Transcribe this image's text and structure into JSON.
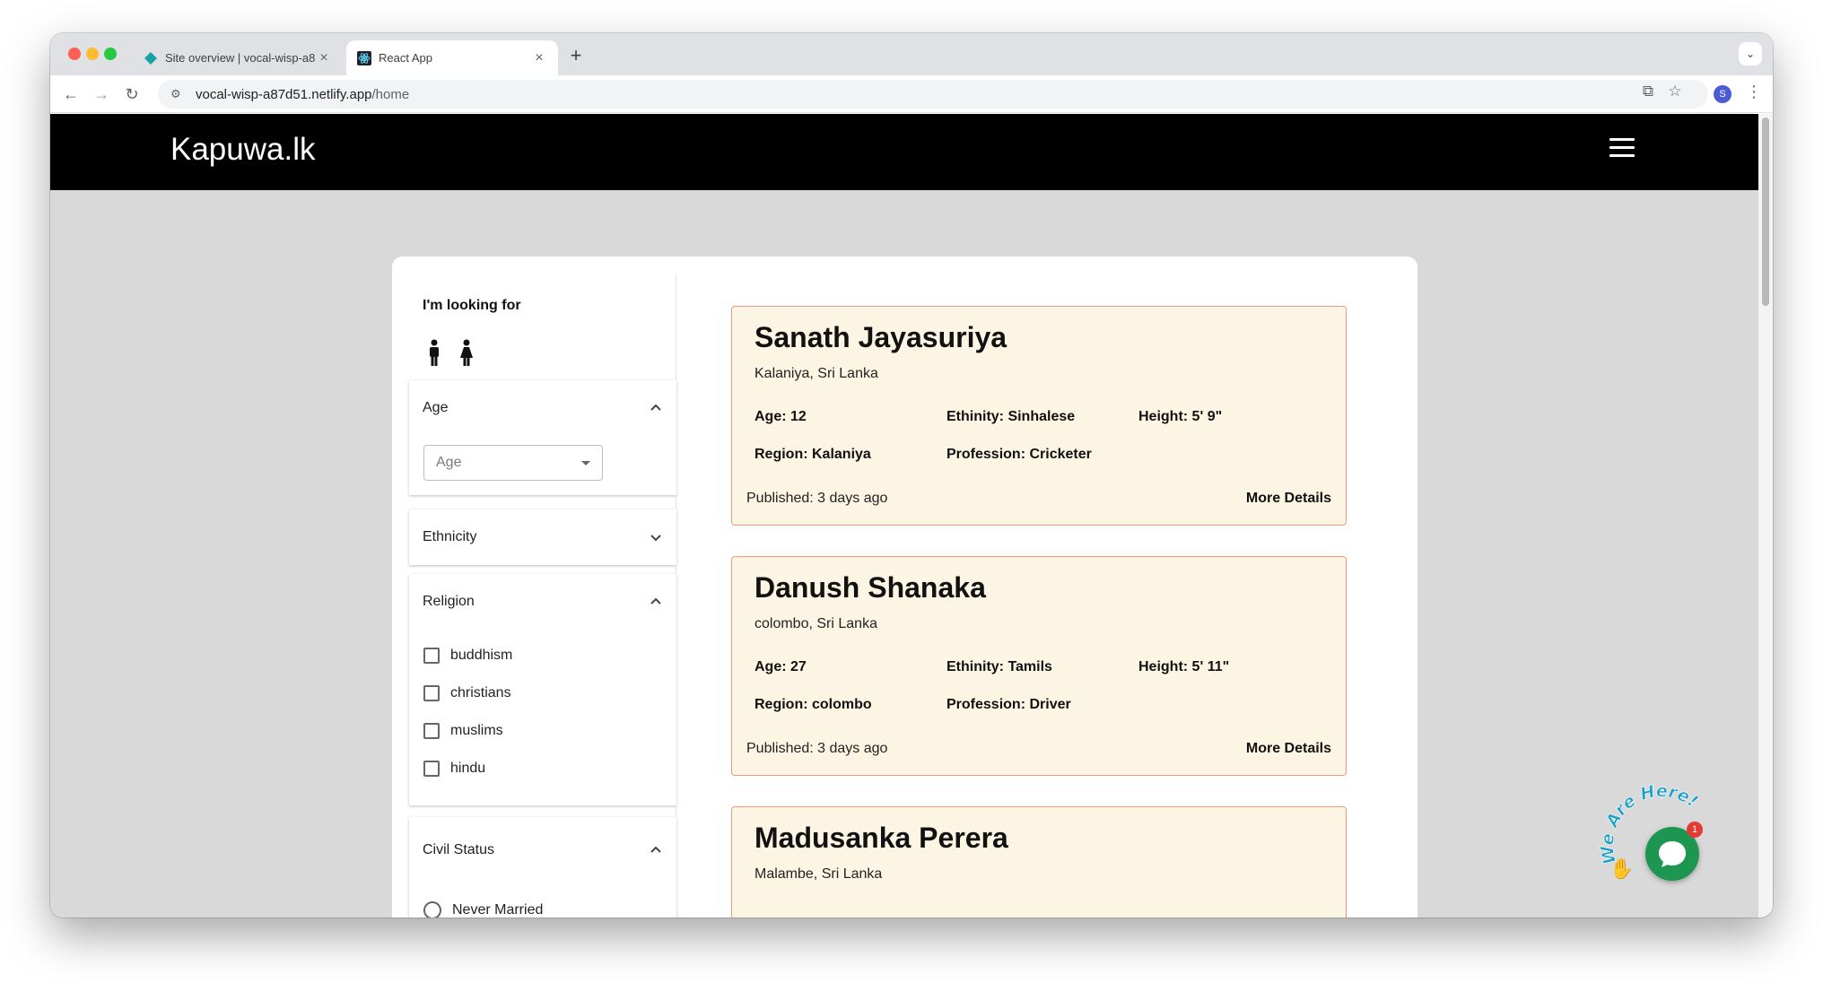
{
  "browser": {
    "tabs": [
      {
        "title": "Site overview | vocal-wisp-a8",
        "active": false
      },
      {
        "title": "React App",
        "active": true
      }
    ],
    "url_domain": "vocal-wisp-a87d51.netlify.app",
    "url_path": "/home",
    "profile_initial": "S"
  },
  "app": {
    "brand": "Kapuwa.lk"
  },
  "filters": {
    "looking_for_label": "I'm looking for",
    "age": {
      "title": "Age",
      "placeholder": "Age"
    },
    "ethnicity": {
      "title": "Ethnicity"
    },
    "religion": {
      "title": "Religion",
      "options": [
        "buddhism",
        "christians",
        "muslims",
        "hindu"
      ]
    },
    "civil_status": {
      "title": "Civil Status",
      "options": [
        "Never Married"
      ]
    }
  },
  "profiles": [
    {
      "name": "Sanath Jayasuriya",
      "location": "Kalaniya, Sri Lanka",
      "age": "Age: 12",
      "ethnicity": "Ethinity: Sinhalese",
      "height": "Height: 5' 9\"",
      "region": "Region: Kalaniya",
      "profession": "Profession: Cricketer",
      "published": "Published: 3 days ago",
      "more": "More Details"
    },
    {
      "name": "Danush Shanaka",
      "location": "colombo, Sri Lanka",
      "age": "Age: 27",
      "ethnicity": "Ethinity: Tamils",
      "height": "Height: 5' 11\"",
      "region": "Region: colombo",
      "profession": "Profession: Driver",
      "published": "Published: 3 days ago",
      "more": "More Details"
    },
    {
      "name": "Madusanka Perera",
      "location": "Malambe, Sri Lanka"
    }
  ],
  "chat_widget": {
    "curved_text": "We Are Here!",
    "badge_count": "1"
  },
  "colors": {
    "appbar": "#000000",
    "card_bg": "#fdf5e3",
    "card_border": "#f09a7a",
    "chat_green": "#1c9650"
  }
}
